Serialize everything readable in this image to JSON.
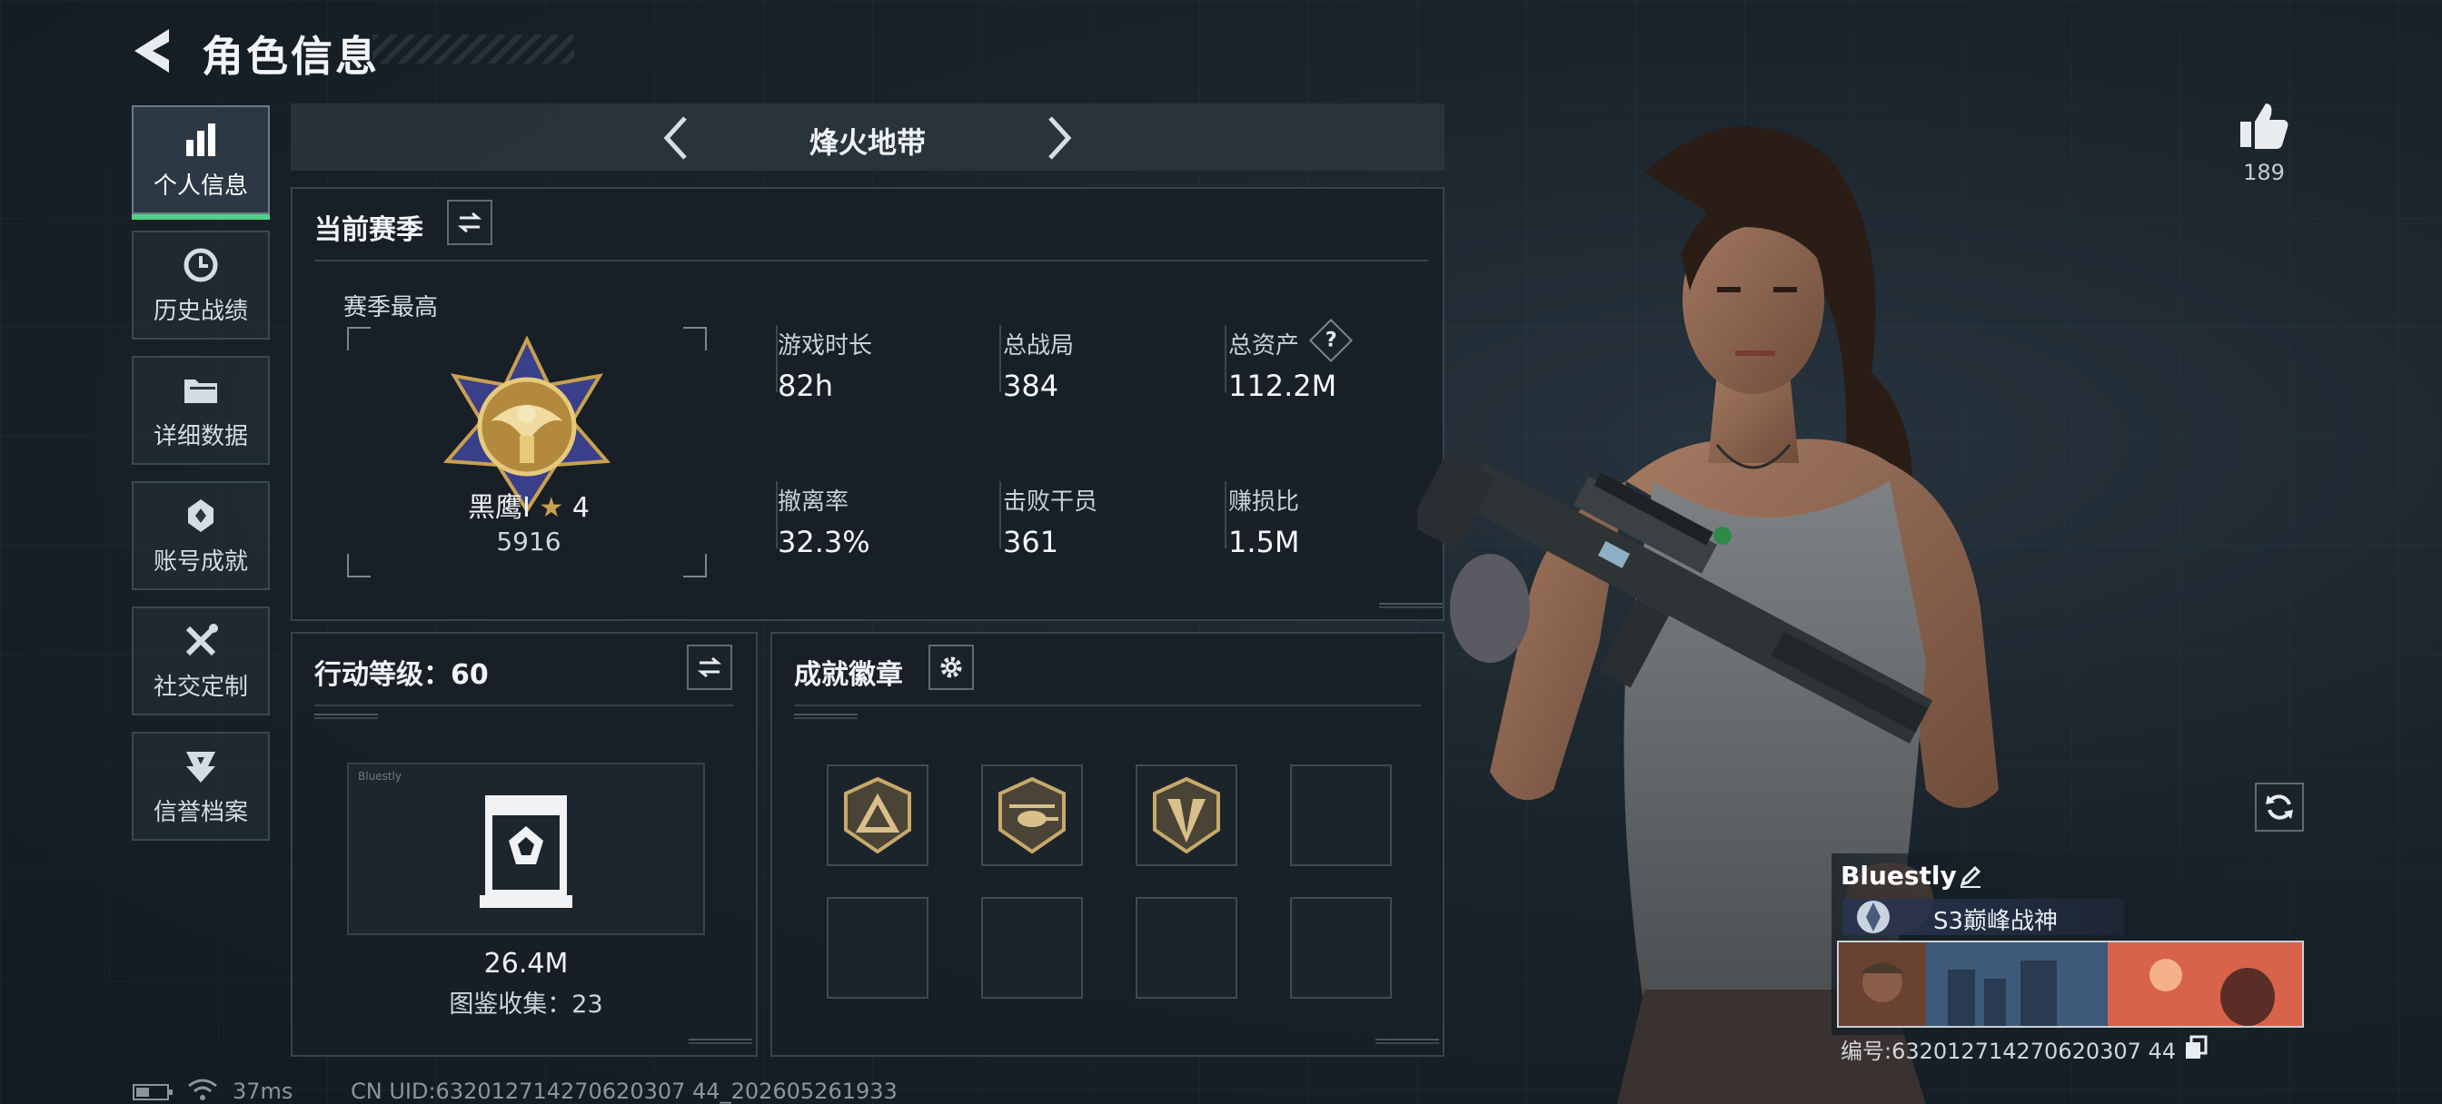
{
  "header": {
    "title": "角色信息"
  },
  "sidebar": {
    "items": [
      {
        "label": "个人信息",
        "icon": "bar-chart-icon",
        "active": true
      },
      {
        "label": "历史战绩",
        "icon": "history-clock-icon",
        "active": false
      },
      {
        "label": "详细数据",
        "icon": "folder-icon",
        "active": false
      },
      {
        "label": "账号成就",
        "icon": "achievement-medal-icon",
        "active": false
      },
      {
        "label": "社交定制",
        "icon": "wrench-tools-icon",
        "active": false
      },
      {
        "label": "信誉档案",
        "icon": "shield-chevron-icon",
        "active": false
      }
    ]
  },
  "mode_tab": {
    "title": "烽火地带"
  },
  "season": {
    "title": "当前赛季",
    "best_label": "赛季最高",
    "rank_name": "黑鹰Ⅰ",
    "rank_stars": "4",
    "rank_points": "5916",
    "stats": [
      {
        "label": "游戏时长",
        "value": "82h"
      },
      {
        "label": "总战局",
        "value": "384"
      },
      {
        "label": "总资产",
        "value": "112.2M"
      },
      {
        "label": "撤离率",
        "value": "32.3%"
      },
      {
        "label": "击败干员",
        "value": "361"
      },
      {
        "label": "赚损比",
        "value": "1.5M"
      }
    ],
    "help_glyph": "?"
  },
  "action_level": {
    "title": "行动等级：60",
    "card_small_title": "Bluestly",
    "collection_value": "26.4M",
    "collection_label": "图鉴收集：23"
  },
  "achievements": {
    "title": "成就徽章",
    "slots": [
      {
        "icon": "triangle-emblem-icon",
        "filled": true
      },
      {
        "icon": "helicopter-emblem-icon",
        "filled": true
      },
      {
        "icon": "arrow-emblem-icon",
        "filled": true
      },
      {
        "icon": "",
        "filled": false
      },
      {
        "icon": "",
        "filled": false
      },
      {
        "icon": "",
        "filled": false
      },
      {
        "icon": "",
        "filled": false
      },
      {
        "icon": "",
        "filled": false
      }
    ]
  },
  "likes": {
    "count": "189",
    "icon": "thumbs-up-icon"
  },
  "profile_card": {
    "name": "Bluestly",
    "title": "S3巅峰战神",
    "uid": "编号:632012714270620307 44"
  },
  "footer": {
    "ping": "37ms",
    "uid_line": "CN UID:632012714270620307 44_202605261933"
  },
  "colors": {
    "accent_green": "#4fd18a",
    "panel_border": "#36434d",
    "gold": "#c8a050"
  }
}
